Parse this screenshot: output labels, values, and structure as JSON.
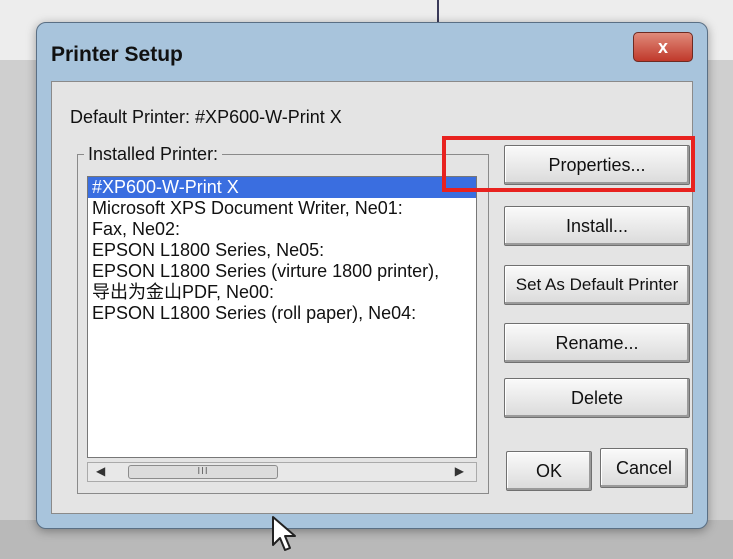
{
  "window": {
    "title": "Printer Setup",
    "close_glyph": "x"
  },
  "default_printer_label": "Default Printer: #XP600-W-Print X",
  "installed_group": {
    "label": "Installed Printer:",
    "items": [
      "#XP600-W-Print X",
      "Microsoft XPS Document Writer, Ne01:",
      "Fax, Ne02:",
      "EPSON L1800 Series, Ne05:",
      "EPSON L1800 Series (virture 1800 printer),",
      "导出为金山PDF, Ne00:",
      "EPSON L1800 Series (roll paper), Ne04:"
    ],
    "selected_index": 0,
    "scroll_thumb_glyph": "III"
  },
  "buttons": {
    "properties": "Properties...",
    "install": "Install...",
    "set_default": "Set As Default Printer",
    "rename": "Rename...",
    "delete": "Delete",
    "ok": "OK",
    "cancel": "Cancel"
  },
  "icons": {
    "close": "close-icon",
    "scroll_left": "scroll-left-arrow-icon",
    "scroll_right": "scroll-right-arrow-icon",
    "cursor": "mouse-cursor-icon"
  },
  "colors": {
    "selection": "#3a6ee0",
    "highlight_box": "#e8221f",
    "close_button": "#c0392b"
  }
}
